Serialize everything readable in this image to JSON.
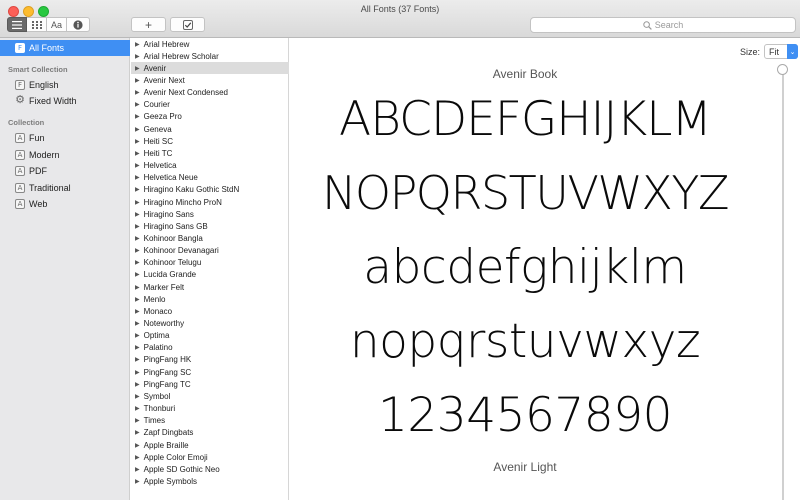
{
  "window": {
    "title": "All Fonts (37 Fonts)"
  },
  "toolbar": {
    "view_text_label": "Aa",
    "add_label": "+",
    "search_placeholder": "Search"
  },
  "sidebar": {
    "all_fonts": "All Fonts",
    "smart_collection_heading": "Smart Collection",
    "smart_items": [
      {
        "label": "English",
        "icon": "F"
      },
      {
        "label": "Fixed Width",
        "icon": "gear"
      }
    ],
    "collection_heading": "Collection",
    "collection_items": [
      {
        "label": "Fun",
        "icon": "A"
      },
      {
        "label": "Modern",
        "icon": "A"
      },
      {
        "label": "PDF",
        "icon": "A"
      },
      {
        "label": "Traditional",
        "icon": "A"
      },
      {
        "label": "Web",
        "icon": "A"
      }
    ]
  },
  "font_list": [
    "Arial Hebrew",
    "Arial Hebrew Scholar",
    "Avenir",
    "Avenir Next",
    "Avenir Next Condensed",
    "Courier",
    "Geeza Pro",
    "Geneva",
    "Heiti SC",
    "Heiti TC",
    "Helvetica",
    "Helvetica Neue",
    "Hiragino Kaku Gothic StdN",
    "Hiragino Mincho ProN",
    "Hiragino Sans",
    "Hiragino Sans GB",
    "Kohinoor Bangla",
    "Kohinoor Devanagari",
    "Kohinoor Telugu",
    "Lucida Grande",
    "Marker Felt",
    "Menlo",
    "Monaco",
    "Noteworthy",
    "Optima",
    "Palatino",
    "PingFang HK",
    "PingFang SC",
    "PingFang TC",
    "Symbol",
    "Thonburi",
    "Times",
    "Zapf Dingbats",
    "Apple Braille",
    "Apple Color Emoji",
    "Apple SD Gothic Neo",
    "Apple Symbols"
  ],
  "selected_font": "Avenir",
  "preview": {
    "size_label": "Size:",
    "size_value": "Fit",
    "face_name": "Avenir Book",
    "lines": [
      "ABCDEFGHIJKLM",
      "NOPQRSTUVWXYZ",
      "abcdefghijklm",
      "nopqrstuvwxyz",
      "1234567890"
    ],
    "next_face_name": "Avenir Light"
  },
  "colors": {
    "selection_blue": "#3f8ff3",
    "sidebar_bg": "#e8e8ea"
  }
}
